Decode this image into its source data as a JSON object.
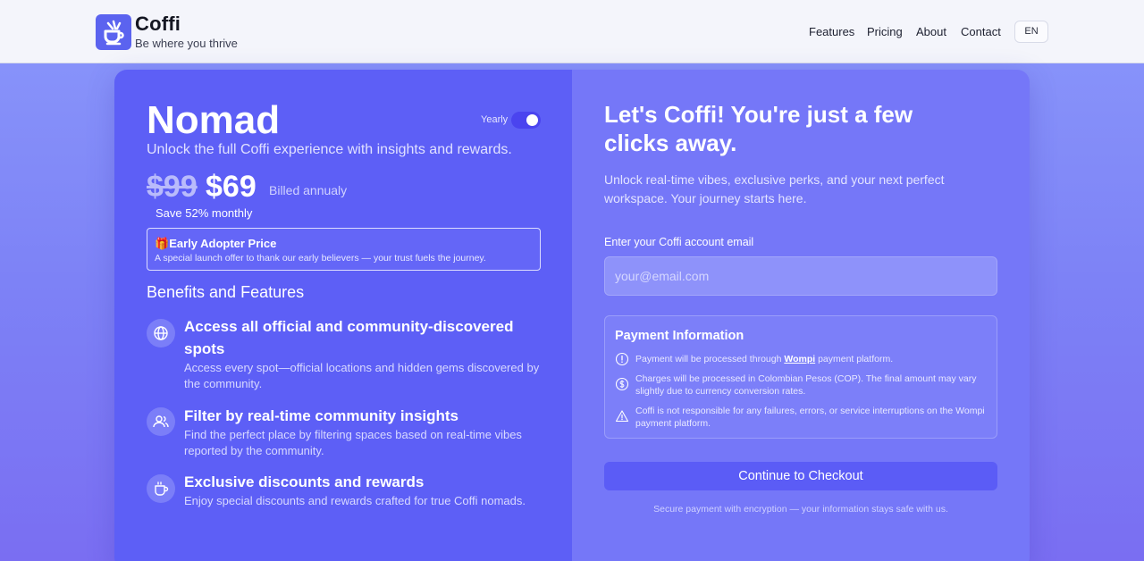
{
  "header": {
    "brand": "Coffi",
    "tagline": "Be where you thrive",
    "nav": [
      "Features",
      "Pricing",
      "About",
      "Contact"
    ],
    "language": "EN"
  },
  "plan": {
    "name": "Nomad",
    "subtitle": "Unlock the full Coffi experience with insights and rewards.",
    "toggle_label": "Yearly",
    "toggle_on": true,
    "old_price": "$99",
    "new_price": "$69",
    "billed": "Billed annualy",
    "save": "Save 52% monthly",
    "early_icon": "🎁",
    "early_title": "Early Adopter Price",
    "early_desc": "A special launch offer to thank our early believers — your trust fuels the journey.",
    "benefits_title": "Benefits and Features",
    "features": [
      {
        "icon": "globe-icon",
        "title": "Access all official and community-discovered spots",
        "desc": "Access every spot—official locations and hidden gems discovered by the community."
      },
      {
        "icon": "users-icon",
        "title": "Filter by real-time community insights",
        "desc": "Find the perfect place by filtering spaces based on real-time vibes reported by the community."
      },
      {
        "icon": "coffee-cup-icon",
        "title": "Exclusive discounts and rewards",
        "desc": "Enjoy special discounts and rewards crafted for true Coffi nomads."
      }
    ]
  },
  "checkout": {
    "headline": "Let's Coffi! You're just a few clicks away.",
    "intro": "Unlock real-time vibes, exclusive perks, and your next perfect workspace. Your journey starts here.",
    "email_label": "Enter your Coffi account email",
    "email_placeholder": "your@email.com",
    "payment_title": "Payment Information",
    "payment_items": [
      {
        "icon": "info-circle-icon",
        "pre": "Payment will be processed through ",
        "link": "Wompi",
        "post": " payment platform."
      },
      {
        "icon": "dollar-circle-icon",
        "text": "Charges will be processed in Colombian Pesos (COP). The final amount may vary slightly due to currency conversion rates."
      },
      {
        "icon": "warning-triangle-icon",
        "text": "Coffi is not responsible for any failures, errors, or service interruptions on the Wompi payment platform."
      }
    ],
    "button": "Continue to Checkout",
    "secure_note": "Secure payment with encryption — your information stays safe with us."
  }
}
